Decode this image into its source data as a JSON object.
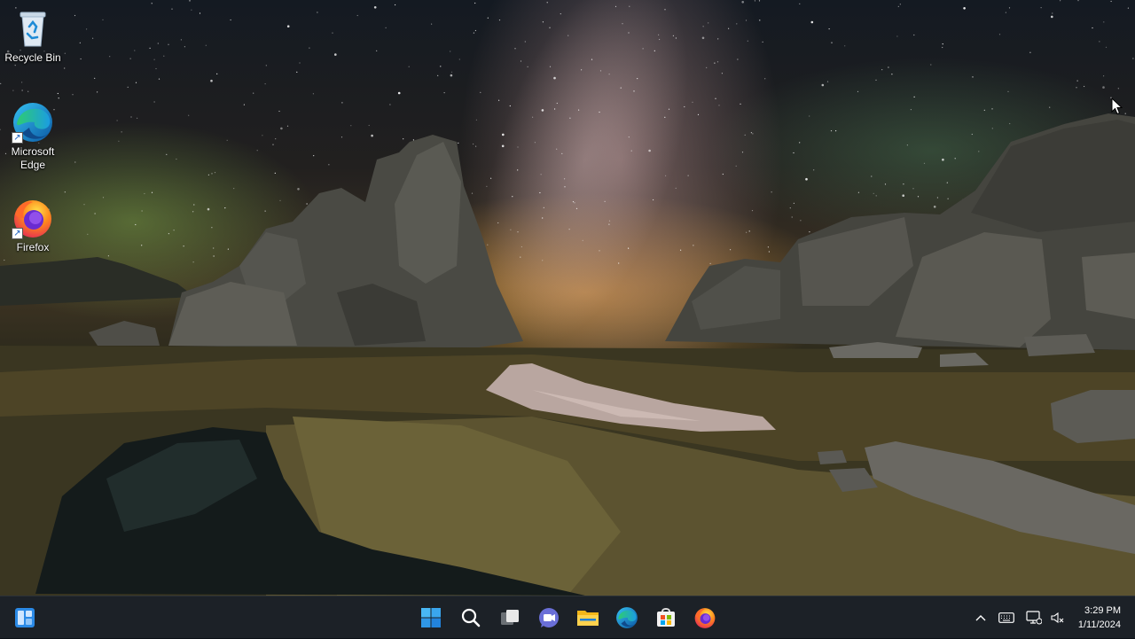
{
  "desktop": {
    "icons": [
      {
        "label": "Recycle Bin",
        "icon": "recycle-bin-icon"
      },
      {
        "label": "Microsoft Edge",
        "icon": "edge-icon",
        "shortcut": true
      },
      {
        "label": "Firefox",
        "icon": "firefox-icon",
        "shortcut": true
      }
    ]
  },
  "taskbar": {
    "widgets_icon": "widgets-icon",
    "apps": [
      {
        "name": "Start",
        "icon": "windows-start-icon"
      },
      {
        "name": "Search",
        "icon": "search-icon"
      },
      {
        "name": "Task View",
        "icon": "task-view-icon"
      },
      {
        "name": "Chat",
        "icon": "chat-icon"
      },
      {
        "name": "File Explorer",
        "icon": "folder-icon"
      },
      {
        "name": "Microsoft Edge",
        "icon": "edge-icon"
      },
      {
        "name": "Microsoft Store",
        "icon": "store-icon"
      },
      {
        "name": "Firefox",
        "icon": "firefox-icon"
      }
    ],
    "tray": {
      "icons": [
        "chevron-up-icon",
        "keyboard-icon",
        "network-icon",
        "volume-muted-icon"
      ]
    },
    "clock": {
      "time": "3:29 PM",
      "date": "1/11/2024"
    }
  },
  "colors": {
    "taskbar_bg": "#1c2127",
    "accent_blue": "#2b8ae6"
  }
}
